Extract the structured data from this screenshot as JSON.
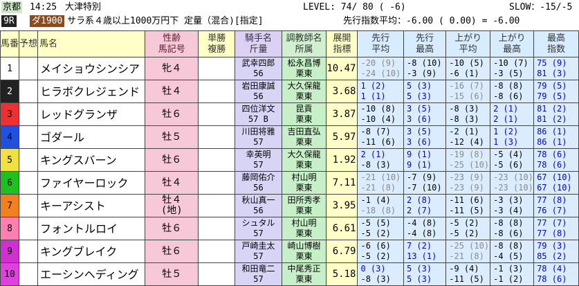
{
  "header": {
    "venue": "京都",
    "time": "14:25",
    "race_name": "大津特別",
    "level": "LEVEL: 74/ 80 ( -6)",
    "slow": "SLOW：-15/-5",
    "race_no": "9R",
    "distance": "ダ1900",
    "conditions": "サラ系４歳以上1000万円下 定量（混合)[指定]",
    "avg": "先行指数平均：-6.00 ( 0.00) = -6.00"
  },
  "columns": {
    "c1": "馬番",
    "c2": "予想",
    "c3": "馬名",
    "c4a": "性齢",
    "c4b": "馬記号",
    "c5a": "単勝",
    "c5b": "複勝",
    "c6a": "騎手名",
    "c6b": "斤量",
    "c7a": "調教師名",
    "c7b": "所属",
    "c8a": "展開",
    "c8b": "指標",
    "c9a": "先行",
    "c9b": "平均",
    "c10a": "先行",
    "c10b": "最高",
    "c11a": "上がり",
    "c11b": "平均",
    "c12a": "上がり",
    "c12b": "最高",
    "c13a": "最高",
    "c13b": "指数"
  },
  "colors": {
    "row_colors": [
      "#ffffff",
      "#222222",
      "#ee3030",
      "#2050e0",
      "#f0e040",
      "#20c020",
      "#f08020",
      "#ff80b0",
      "#d030d0",
      "#e040e0"
    ],
    "blue": "#0000dd",
    "green": "#008800",
    "grey": "#8a8a8a",
    "red": "#cc0000",
    "black": "#000000"
  },
  "rows": [
    {
      "no": "1",
      "name": "メイショウシンシア",
      "sex": "牝４",
      "mark": "",
      "jockey": "武幸四郎",
      "weight": "56",
      "trainer": "松永昌博",
      "stable": "栗東",
      "idx": "10.47",
      "s1a": "-20 (9)",
      "s1b": "-24 (10)",
      "s2a": "-8 (10)",
      "s2b": "-3 (9)",
      "s3a": "-10 (5)",
      "s3b": "-6 (1)",
      "s4a": "-10 (7)",
      "s4b": "-3 (5)",
      "s5a": "75 (9)",
      "s5b": "81 (3)"
    },
    {
      "no": "2",
      "name": "ヒラボクレジェンド",
      "sex": "牡４",
      "mark": "",
      "jockey": "岩田康誠",
      "weight": "56",
      "trainer": "大久保龍",
      "stable": "栗東",
      "idx": "3.68",
      "s1a": "1 (2)",
      "s1b": "1 (1)",
      "s2a": "5 (3)",
      "s2b": "5 (3)",
      "s3a": "-16 (7)",
      "s3b": "-15 (6)",
      "s4a": "-8 (8)",
      "s4b": "-8 (6)",
      "s5a": "79 (5)",
      "s5b": "79 (5)"
    },
    {
      "no": "3",
      "name": "レッドグランザ",
      "sex": "牡６",
      "mark": "",
      "jockey": "四位洋文",
      "weight": "57 B",
      "trainer": "昆貢",
      "stable": "栗東",
      "idx": "3.87",
      "s1a": "-10 (8)",
      "s1b": "-10 (4)",
      "s2a": "3 (5)",
      "s2b": "3 (6)",
      "s3a": "-8 (3)",
      "s3b": "-8 (3)",
      "s4a": "2 (1)",
      "s4b": "2 (1)",
      "s5a": "81 (2)",
      "s5b": "81 (2)"
    },
    {
      "no": "4",
      "name": "ゴダール",
      "sex": "牡５",
      "mark": "",
      "jockey": "川田将雅",
      "weight": "57",
      "trainer": "吉田直弘",
      "stable": "栗東",
      "idx": "5.97",
      "s1a": "-8 (7)",
      "s1b": "-11 (6)",
      "s2a": "3 (5)",
      "s2b": "3 (6)",
      "s3a": "-2 (1)",
      "s3b": "-12 (4)",
      "s4a": "1 (2)",
      "s4b": "1 (3)",
      "s5a": "86 (1)",
      "s5b": "86 (1)"
    },
    {
      "no": "5",
      "name": "キングスバーン",
      "sex": "牡６",
      "mark": "",
      "jockey": "幸英明",
      "weight": "57",
      "trainer": "大久保龍",
      "stable": "栗東",
      "idx": "1.92",
      "s1a": "2 (1)",
      "s1b": "-8 (3)",
      "s2a": "9 (1)",
      "s2b": "9 (1)",
      "s3a": "-19 (8)",
      "s3b": "-25 (10)",
      "s4a": "-5 (4)",
      "s4b": "-5 (6)",
      "s5a": "78 (6)",
      "s5b": "78 (6)"
    },
    {
      "no": "6",
      "name": "ファイヤーロック",
      "sex": "牡４",
      "mark": "",
      "jockey": "藤岡佑介",
      "weight": "56",
      "trainer": "村山明",
      "stable": "栗東",
      "idx": "7.11",
      "s1a": "-21 (10)",
      "s1b": "-21 (8)",
      "s2a": "-7 (9)",
      "s2b": "-7 (10)",
      "s3a": "-23 (9)",
      "s3b": "-23 (9)",
      "s4a": "-23 (10)",
      "s4b": "-23 (10)",
      "s5a": "67 (10)",
      "s5b": "67 (10)"
    },
    {
      "no": "7",
      "name": "キーアシスト",
      "sex": "牡４",
      "mark": "(地)",
      "jockey": "秋山真一",
      "weight": "56",
      "trainer": "田所秀孝",
      "stable": "栗東",
      "idx": "3.95",
      "s1a": "-1 (4)",
      "s1b": "-18 (8)",
      "s2a": "2 (8)",
      "s2b": "2 (7)",
      "s3a": "-11 (6)",
      "s3b": "-11 (5)",
      "s4a": "-3 (3)",
      "s4b": "-3 (4)",
      "s5a": "77 (8)",
      "s5b": "76 (7)"
    },
    {
      "no": "8",
      "name": "フォントルロイ",
      "sex": "牡６",
      "mark": "",
      "jockey": "シュタル",
      "weight": "57",
      "trainer": "村山明",
      "stable": "栗東",
      "idx": "6.61",
      "s1a": "-5 (5)",
      "s1b": "-5 (2)",
      "s2a": "-4 (8)",
      "s2b": "-4 (8)",
      "s3a": "-5 (2)",
      "s3b": "-5 (2)",
      "s4a": "-8 (8)",
      "s4b": "-8 (6)",
      "s5a": "77 (7)",
      "s5b": "77 (8)"
    },
    {
      "no": "9",
      "name": "キングブレイク",
      "sex": "牡６",
      "mark": "",
      "jockey": "戸崎圭太",
      "weight": "57",
      "trainer": "崎山博樹",
      "stable": "栗東",
      "idx": "6.79",
      "s1a": "-6 (6)",
      "s1b": "-5 (2)",
      "s2a": "7 (2)",
      "s2b": "13 (1)",
      "s3a": "-25 (10)",
      "s3b": "-21 (8)",
      "s4a": "-8 (8)",
      "s4b": "-4 (5)",
      "s5a": "79 (3)",
      "s5b": "85 (2)"
    },
    {
      "no": "10",
      "name": "エーシンヘディング",
      "sex": "牡５",
      "mark": "",
      "jockey": "和田竜二",
      "weight": "57",
      "trainer": "中尾秀正",
      "stable": "栗東",
      "idx": "5.18",
      "s1a": "0 (3)",
      "s1b": "-8 (3)",
      "s2a": "5 (3)",
      "s2b": "5 (3)",
      "s3a": "-9 (4)",
      "s3b": "-11 (5)",
      "s4a": "-1 (3)",
      "s4b": "-1 (2)",
      "s5a": "78 (4)",
      "s5b": "78 (6)"
    }
  ]
}
